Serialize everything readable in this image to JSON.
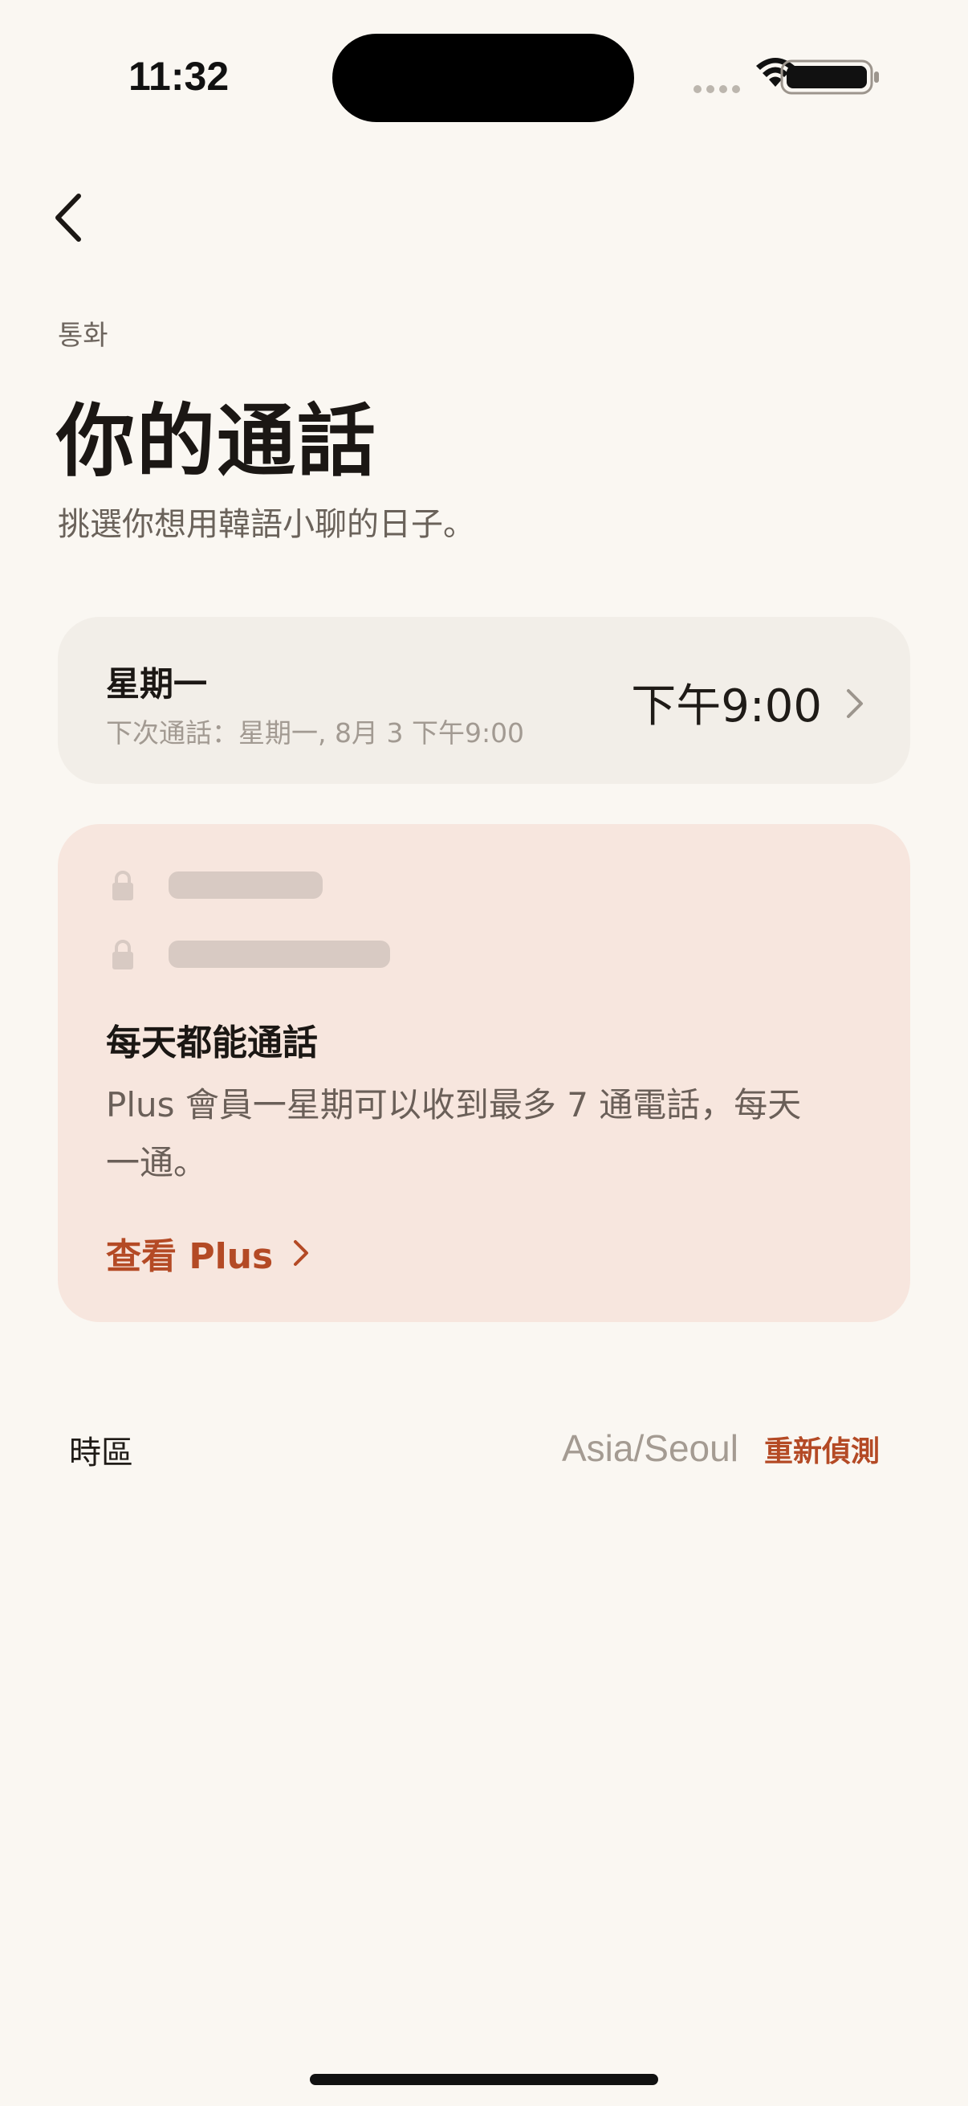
{
  "status_bar": {
    "time": "11:32",
    "icons": [
      "signal-dots-icon",
      "wifi-icon",
      "battery-icon"
    ]
  },
  "nav": {
    "back_icon": "chevron-left-icon"
  },
  "header": {
    "eyebrow": "통화",
    "title": "你的通話",
    "subtitle": "挑選你想用韓語小聊的日子。"
  },
  "schedule": {
    "day": "星期一",
    "next_call": "下次通話：星期一, 8月 3 下午9:00",
    "time": "下午9:00"
  },
  "plus_card": {
    "heading": "每天都能通話",
    "body": "Plus 會員一星期可以收到最多 7 通電話，每天一通。",
    "link": "查看 Plus"
  },
  "timezone": {
    "label": "時區",
    "value": "Asia/Seoul",
    "redetect": "重新偵測"
  },
  "colors": {
    "background": "#faf7f2",
    "accent": "#b44a25",
    "plus_card_bg": "#f7e6de",
    "schedule_card_bg": "#f2eee8"
  }
}
